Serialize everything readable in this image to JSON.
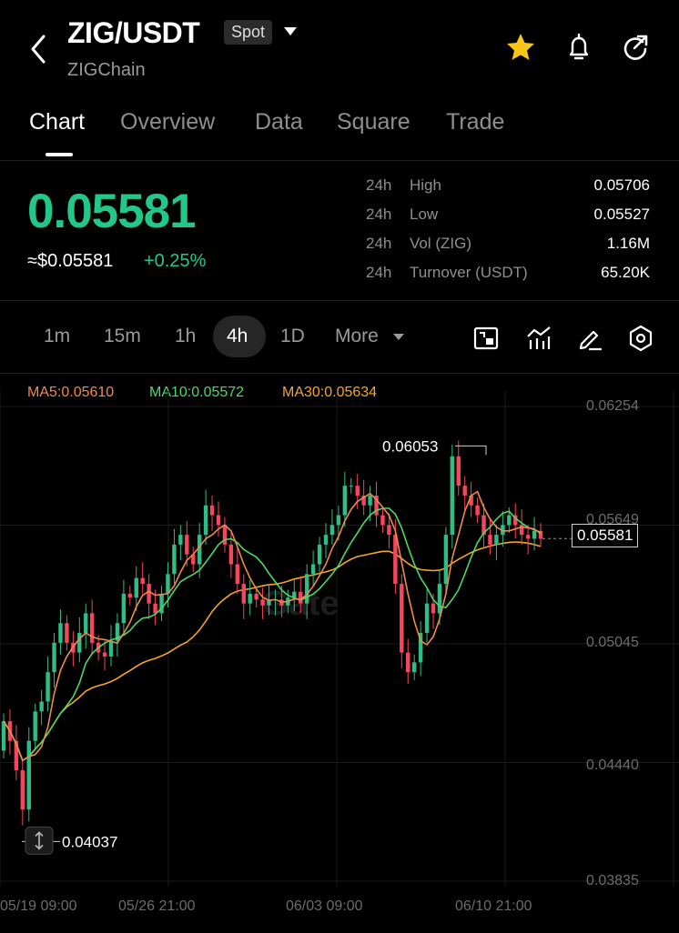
{
  "header": {
    "pair": "ZIG/USDT",
    "market_badge": "Spot",
    "chain": "ZIGChain",
    "icons": [
      "back-icon",
      "star-icon",
      "bell-icon",
      "share-icon"
    ],
    "favorite_color": "#f5c518"
  },
  "tabs": [
    "Chart",
    "Overview",
    "Data",
    "Square",
    "Trade"
  ],
  "active_tab": "Chart",
  "price": {
    "last": "0.05581",
    "usd": "≈$0.05581",
    "change": "+0.25%",
    "up_color": "#22c88a"
  },
  "stats": [
    {
      "period": "24h",
      "label": "High",
      "value": "0.05706"
    },
    {
      "period": "24h",
      "label": "Low",
      "value": "0.05527"
    },
    {
      "period": "24h",
      "label": "Vol (ZIG)",
      "value": "1.16M"
    },
    {
      "period": "24h",
      "label": "Turnover (USDT)",
      "value": "65.20K"
    }
  ],
  "intervals": [
    "1m",
    "15m",
    "1h",
    "4h",
    "1D",
    "More"
  ],
  "active_interval": "4h",
  "tools": [
    "fullscreen-icon",
    "indicator-icon",
    "draw-icon",
    "settings-icon"
  ],
  "ma": {
    "ma5": "MA5:0.05610",
    "ma10": "MA10:0.05572",
    "ma30": "MA30:0.05634",
    "ma5_color": "#f08a4b",
    "ma10_color": "#4cd964",
    "ma30_color": "#f5a623"
  },
  "chart_data": {
    "type": "candlestick",
    "y_ticks": [
      "0.06254",
      "0.05649",
      "0.05045",
      "0.04440",
      "0.03835"
    ],
    "ylim": [
      0.03835,
      0.06254
    ],
    "x_ticks": [
      "05/19 09:00",
      "05/26 21:00",
      "06/03 09:00",
      "06/10 21:00"
    ],
    "max_label": "0.06053",
    "min_label": "0.04037",
    "last_price_label": "0.05581",
    "watermark": "Gate",
    "up_color": "#2ebd85",
    "down_color": "#f6465d",
    "candles_close": [
      0.0465,
      0.0455,
      0.044,
      0.042,
      0.0455,
      0.047,
      0.0475,
      0.049,
      0.0505,
      0.0515,
      0.0505,
      0.05,
      0.051,
      0.052,
      0.0505,
      0.05,
      0.0498,
      0.0506,
      0.0515,
      0.053,
      0.0528,
      0.0538,
      0.0535,
      0.0525,
      0.052,
      0.053,
      0.054,
      0.0555,
      0.056,
      0.055,
      0.0545,
      0.056,
      0.0575,
      0.057,
      0.0565,
      0.0555,
      0.0545,
      0.0535,
      0.0525,
      0.053,
      0.0527,
      0.0524,
      0.0527,
      0.0527,
      0.0524,
      0.0528,
      0.0531,
      0.0525,
      0.054,
      0.0545,
      0.0555,
      0.056,
      0.0565,
      0.057,
      0.0585,
      0.0585,
      0.058,
      0.0575,
      0.058,
      0.057,
      0.0565,
      0.056,
      0.0535,
      0.05,
      0.049,
      0.0495,
      0.051,
      0.0525,
      0.052,
      0.0535,
      0.056,
      0.06,
      0.0585,
      0.058,
      0.0575,
      0.057,
      0.056,
      0.0555,
      0.056,
      0.0565,
      0.057,
      0.0565,
      0.056,
      0.0558,
      0.0562,
      0.0558
    ]
  }
}
